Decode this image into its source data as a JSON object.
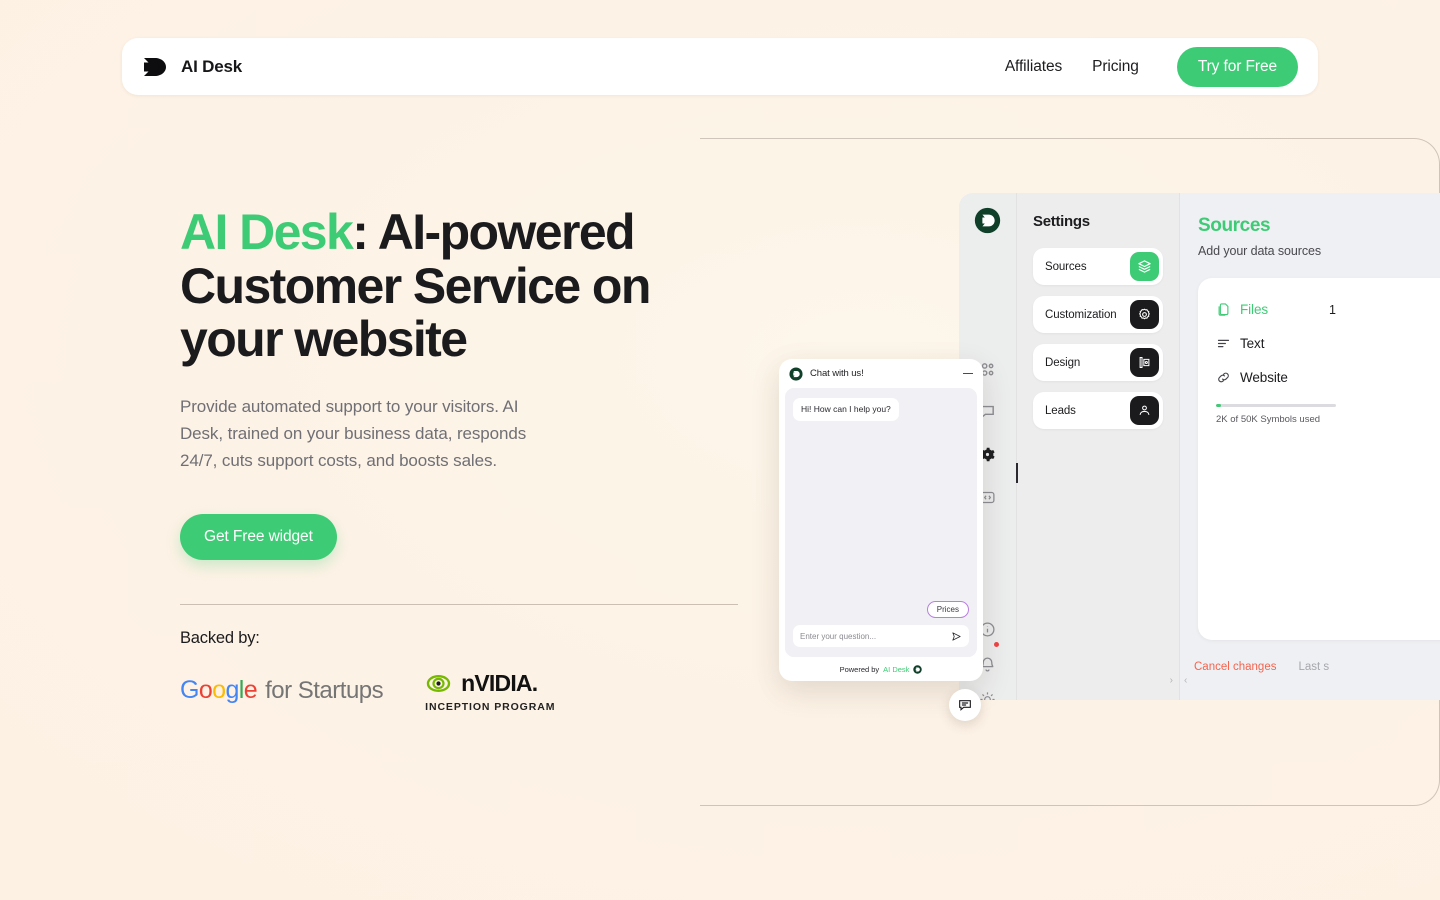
{
  "header": {
    "logo_icon": "aidesk-d-logo",
    "brand_name": "AI Desk",
    "nav": [
      {
        "label": "Affiliates"
      },
      {
        "label": "Pricing"
      }
    ],
    "cta_label": "Try for Free"
  },
  "hero": {
    "headline_accent": "AI Desk",
    "headline_rest": ": AI-powered Customer Service on your website",
    "subhead": "Provide automated support to your visitors. AI Desk, trained on your business data, responds 24/7, cuts support costs, and boosts sales.",
    "cta_label": "Get Free widget",
    "backed_label": "Backed by:",
    "partners": {
      "google": {
        "word_letters": [
          "G",
          "o",
          "o",
          "g",
          "l",
          "e"
        ],
        "suffix": "for Startups"
      },
      "nvidia": {
        "word": "nVIDIA.",
        "subtitle": "INCEPTION PROGRAM"
      }
    }
  },
  "dashboard": {
    "rail": {
      "logo_icon": "aidesk-circle-logo",
      "icons": [
        {
          "name": "users-icon"
        },
        {
          "name": "chat-bubble-icon"
        },
        {
          "name": "gear-icon",
          "active": true
        },
        {
          "name": "code-brackets-icon"
        }
      ],
      "bottom_icons": [
        {
          "name": "info-icon"
        },
        {
          "name": "bell-icon",
          "dot": true
        },
        {
          "name": "sun-icon"
        }
      ]
    },
    "settings": {
      "title": "Settings",
      "items": [
        {
          "label": "Sources",
          "icon": "layers-icon",
          "active": true
        },
        {
          "label": "Customization",
          "icon": "gear-icon",
          "active": false
        },
        {
          "label": "Design",
          "icon": "palette-icon",
          "active": false
        },
        {
          "label": "Leads",
          "icon": "people-icon",
          "active": false
        }
      ]
    },
    "sources": {
      "title": "Sources",
      "subtitle": "Add your data sources",
      "items": [
        {
          "label": "Files",
          "icon": "files-icon",
          "count": "1",
          "active": true
        },
        {
          "label": "Text",
          "icon": "text-lines-icon",
          "active": false
        },
        {
          "label": "Website",
          "icon": "link-icon",
          "active": false
        }
      ],
      "usage_label": "2K of 50K Symbols used",
      "usage_percent": 4,
      "cancel_label": "Cancel changes",
      "last_saved_label": "Last s"
    }
  },
  "chat_widget": {
    "logo_icon": "aidesk-circle-logo",
    "title": "Chat with us!",
    "minimize_icon": "minimize-icon",
    "messages": [
      {
        "text": "Hi! How can I help you?",
        "from": "bot"
      }
    ],
    "quick_reply": "Prices",
    "input_placeholder": "Enter your question...",
    "send_icon": "send-icon",
    "footer_prefix": "Powered by",
    "footer_brand": "AI Desk"
  },
  "fab": {
    "icon": "chat-bubble-icon"
  },
  "colors": {
    "brand_green": "#3ecb75",
    "page_bg": "#fdf2e6",
    "text_dark": "#1b1b1e",
    "text_muted": "#6f6f75",
    "danger": "#f2654f",
    "chip_border": "#b97fe0"
  }
}
